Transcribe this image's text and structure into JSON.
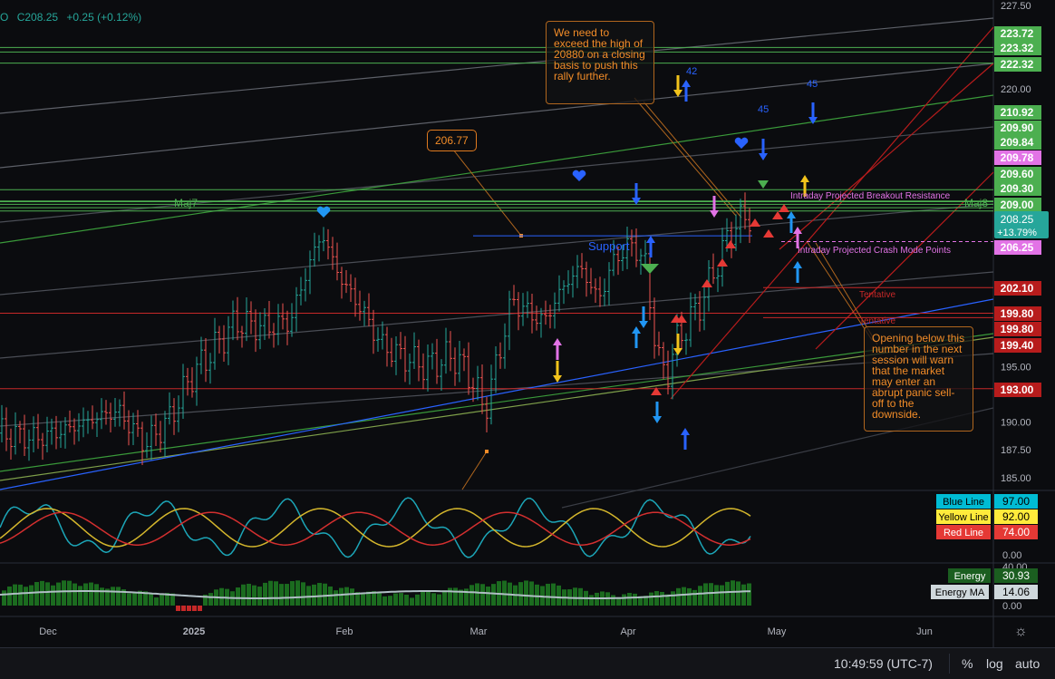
{
  "header": {
    "prefix": "O",
    "close": "C208.25",
    "change": "+0.25 (+0.12%)"
  },
  "colors": {
    "background": "#0b0c0f",
    "up": "#26a69a",
    "down": "#ef5350",
    "green_level": "#4caf50",
    "red_level": "#b71c1c",
    "blue_line": "#2962ff",
    "annotation": "#f28c28",
    "pink": "#e273e6",
    "indicator_blue": "#1ca6b8",
    "indicator_yellow": "#d4b62c",
    "indicator_red": "#d32f2f",
    "energy": "#1b6b1f",
    "energy_ma": "#b0bec5"
  },
  "chart_data": {
    "type": "candlestick",
    "x_axis_labels": [
      "Dec",
      "2025",
      "Feb",
      "Mar",
      "Apr",
      "May",
      "Jun"
    ],
    "price_axis_ticks": [
      227.5,
      220,
      195,
      190,
      187.5,
      185
    ],
    "price_range": [
      183.5,
      228
    ],
    "last_price": {
      "value": "208.25",
      "sub": "+13.79%"
    },
    "support_price": 206.77,
    "level_tags": [
      {
        "label": "223.72",
        "kind": "green"
      },
      {
        "label": "223.32",
        "kind": "green"
      },
      {
        "label": "222.32",
        "kind": "green"
      },
      {
        "label": "210.92",
        "kind": "green"
      },
      {
        "label": "209.90",
        "kind": "green"
      },
      {
        "label": "209.84",
        "kind": "green"
      },
      {
        "label": "209.78",
        "kind": "pink"
      },
      {
        "label": "209.60",
        "kind": "green"
      },
      {
        "label": "209.30",
        "kind": "green"
      },
      {
        "label": "209.00",
        "kind": "green"
      },
      {
        "label": "206.25",
        "kind": "pink"
      },
      {
        "label": "202.10",
        "kind": "red"
      },
      {
        "label": "199.80",
        "kind": "red"
      },
      {
        "label": "199.80",
        "kind": "red"
      },
      {
        "label": "199.40",
        "kind": "red"
      },
      {
        "label": "193.00",
        "kind": "red"
      }
    ],
    "oscillator": {
      "series": [
        {
          "name": "Blue Line",
          "value": "97.00"
        },
        {
          "name": "Yellow Line",
          "value": "92.00"
        },
        {
          "name": "Red Line",
          "value": "74.00"
        }
      ],
      "axis_labels": [
        "0.00",
        "40.00"
      ]
    },
    "energy": {
      "series": [
        {
          "name": "Energy",
          "value": "30.93"
        },
        {
          "name": "Energy MA",
          "value": "14.06"
        }
      ],
      "axis_labels": [
        "0.00"
      ]
    }
  },
  "annotations": {
    "top_note": "We need to exceed the high of 20880 on a closing basis to push this rally further.",
    "bottom_note": "Opening below this number in the next session will warn that the market may enter an abrupt panic sell-off to the downside.",
    "support_pill": "206.77",
    "support_label": "Support",
    "breakout_label": "Intraday Projected Breakout Resistance",
    "crash_label": "Intraday Projected Crash Mode Points",
    "tentative_1": "Tentative",
    "tentative_2": "Tentative",
    "maj_left": "Maj7",
    "maj_right": "Maj8",
    "wave_42": "42",
    "wave_45a": "45",
    "wave_45b": "45"
  },
  "bottombar": {
    "time": "10:49:59 (UTC-7)",
    "percent": "%",
    "log": "log",
    "auto": "auto"
  }
}
